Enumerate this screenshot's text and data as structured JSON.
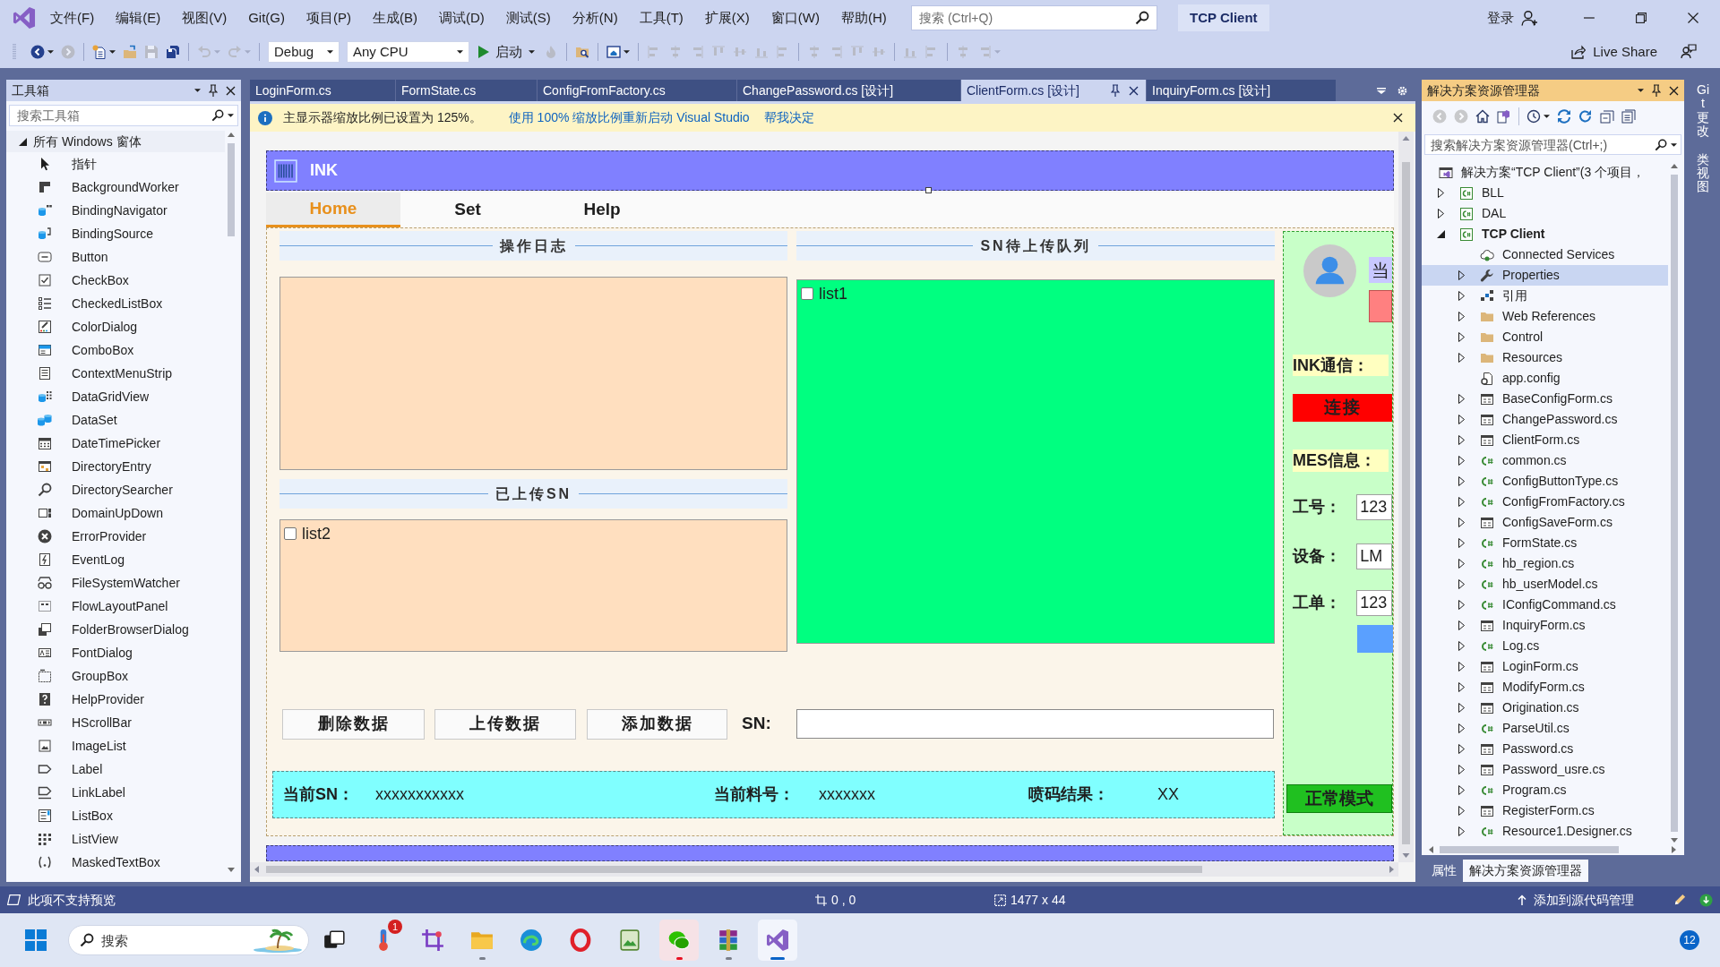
{
  "window": {
    "title": "TCP Client",
    "search_placeholder": "搜索 (Ctrl+Q)",
    "account": "登录"
  },
  "menu": [
    "文件(F)",
    "编辑(E)",
    "视图(V)",
    "Git(G)",
    "项目(P)",
    "生成(B)",
    "调试(D)",
    "测试(S)",
    "分析(N)",
    "工具(T)",
    "扩展(X)",
    "窗口(W)",
    "帮助(H)"
  ],
  "toolbar": {
    "groups": [
      [
        {
          "kind": "back",
          "disabled": false,
          "dropdown": true
        },
        {
          "kind": "forward",
          "disabled": true
        }
      ],
      [
        {
          "kind": "new",
          "disabled": false,
          "dropdown": true
        },
        {
          "kind": "open",
          "disabled": false
        },
        {
          "kind": "save",
          "disabled": true
        },
        {
          "kind": "saveall",
          "disabled": false
        }
      ],
      [
        {
          "kind": "undo",
          "disabled": true,
          "dropdown": true
        },
        {
          "kind": "redo",
          "disabled": true,
          "dropdown": true
        }
      ],
      [
        {
          "kind": "combo",
          "value": "Debug"
        },
        {
          "kind": "combo",
          "value": "Any CPU"
        },
        {
          "kind": "run",
          "label": "启动",
          "dropdown": true
        },
        {
          "kind": "flame",
          "disabled": true
        }
      ],
      [
        {
          "kind": "browse",
          "disabled": false
        }
      ],
      [
        {
          "kind": "designer",
          "disabled": false,
          "dropdown": true
        }
      ],
      [
        {
          "kind": "layout",
          "disabled": true
        },
        {
          "kind": "layout",
          "disabled": true
        },
        {
          "kind": "layout",
          "disabled": true
        },
        {
          "kind": "layout",
          "disabled": true
        },
        {
          "kind": "layout",
          "disabled": true
        },
        {
          "kind": "layout",
          "disabled": true
        },
        {
          "kind": "layout",
          "disabled": true
        }
      ],
      [
        {
          "kind": "layout",
          "disabled": true
        },
        {
          "kind": "layout",
          "disabled": true
        },
        {
          "kind": "layout",
          "disabled": true
        },
        {
          "kind": "layout",
          "disabled": true
        }
      ],
      [
        {
          "kind": "layout",
          "disabled": true
        },
        {
          "kind": "layout",
          "disabled": true
        }
      ],
      [
        {
          "kind": "layout",
          "disabled": true
        },
        {
          "kind": "layout",
          "disabled": true,
          "dropdown": true
        }
      ]
    ],
    "live_share": "Live Share"
  },
  "toolbox": {
    "title": "工具箱",
    "search_placeholder": "搜索工具箱",
    "category": {
      "label": "所有 Windows 窗体",
      "expanded": true
    },
    "items": [
      {
        "label": "指针",
        "kind": "pointer",
        "selected": false
      },
      {
        "label": "BackgroundWorker",
        "kind": "worker",
        "selected": false
      },
      {
        "label": "BindingNavigator",
        "kind": "navigator",
        "selected": false
      },
      {
        "label": "BindingSource",
        "kind": "source",
        "selected": false
      },
      {
        "label": "Button",
        "kind": "button",
        "selected": false
      },
      {
        "label": "CheckBox",
        "kind": "checkbox",
        "selected": false
      },
      {
        "label": "CheckedListBox",
        "kind": "checklist",
        "selected": false
      },
      {
        "label": "ColorDialog",
        "kind": "palette",
        "selected": false
      },
      {
        "label": "ComboBox",
        "kind": "combo",
        "selected": false
      },
      {
        "label": "ContextMenuStrip",
        "kind": "menu",
        "selected": false
      },
      {
        "label": "DataGridView",
        "kind": "grid",
        "selected": false
      },
      {
        "label": "DataSet",
        "kind": "dataset",
        "selected": false
      },
      {
        "label": "DateTimePicker",
        "kind": "calendar",
        "selected": false
      },
      {
        "label": "DirectoryEntry",
        "kind": "directory",
        "selected": false
      },
      {
        "label": "DirectorySearcher",
        "kind": "search",
        "selected": false
      },
      {
        "label": "DomainUpDown",
        "kind": "updown",
        "selected": false
      },
      {
        "label": "ErrorProvider",
        "kind": "error",
        "selected": false
      },
      {
        "label": "EventLog",
        "kind": "log",
        "selected": false
      },
      {
        "label": "FileSystemWatcher",
        "kind": "watcher",
        "selected": false
      },
      {
        "label": "FlowLayoutPanel",
        "kind": "flow",
        "selected": false
      },
      {
        "label": "FolderBrowserDialog",
        "kind": "folderdialog",
        "selected": false
      },
      {
        "label": "FontDialog",
        "kind": "font",
        "selected": false
      },
      {
        "label": "GroupBox",
        "kind": "group",
        "selected": false
      },
      {
        "label": "HelpProvider",
        "kind": "help",
        "selected": false
      },
      {
        "label": "HScrollBar",
        "kind": "hscroll",
        "selected": false
      },
      {
        "label": "ImageList",
        "kind": "image",
        "selected": false
      },
      {
        "label": "Label",
        "kind": "label",
        "selected": false
      },
      {
        "label": "LinkLabel",
        "kind": "link",
        "selected": false
      },
      {
        "label": "ListBox",
        "kind": "listbox",
        "selected": false
      },
      {
        "label": "ListView",
        "kind": "listview",
        "selected": false
      },
      {
        "label": "MaskedTextBox",
        "kind": "masked",
        "selected": false
      }
    ]
  },
  "document_tabs": [
    {
      "label": "LoginForm.cs",
      "selected": false
    },
    {
      "label": "FormState.cs",
      "selected": false
    },
    {
      "label": "ConfigFromFactory.cs",
      "selected": false
    },
    {
      "label": "ChangePassword.cs [设计]",
      "selected": false
    },
    {
      "label": "ClientForm.cs [设计]",
      "selected": true
    },
    {
      "label": "InquiryForm.cs [设计]",
      "selected": false
    }
  ],
  "info_bar": {
    "message": "主显示器缩放比例已设置为 125%。",
    "links": [
      "使用 100% 缩放比例重新启动 Visual Studio",
      "帮我决定"
    ]
  },
  "designer": {
    "form": {
      "title": "INK",
      "tabs": [
        {
          "label": "Home",
          "selected": true
        },
        {
          "label": "Set",
          "selected": false
        },
        {
          "label": "Help",
          "selected": false
        }
      ],
      "log": {
        "title": "操作日志"
      },
      "uploaded": {
        "title": "已上传SN",
        "items": [
          {
            "label": "list2",
            "checked": false
          }
        ]
      },
      "queue": {
        "title": "SN待上传队列",
        "items": [
          {
            "label": "list1",
            "checked": false
          }
        ]
      },
      "buttons": [
        "删除数据",
        "上传数据",
        "添加数据"
      ],
      "sn_label": "SN:",
      "status": [
        {
          "label": "当前SN：",
          "value": "xxxxxxxxxxx"
        },
        {
          "label": "当前料号：",
          "value": "xxxxxxx"
        },
        {
          "label": "喷码结果：",
          "value": "XX"
        }
      ],
      "side": {
        "user_label": "当",
        "ink_label": "INK通信：",
        "connect_button": "连接",
        "mes_label": "MES信息：",
        "fields": [
          {
            "label": "工号：",
            "value": "123"
          },
          {
            "label": "设备：",
            "value": "LM"
          },
          {
            "label": "工单：",
            "value": "123"
          }
        ],
        "mode_button": "正常模式"
      }
    }
  },
  "solution_explorer": {
    "title": "解决方案资源管理器",
    "toolbar": [
      [
        {
          "kind": "back",
          "disabled": true
        },
        {
          "kind": "forward",
          "disabled": true
        },
        {
          "kind": "home",
          "disabled": false
        },
        {
          "kind": "views",
          "disabled": false
        }
      ],
      [
        {
          "kind": "history",
          "disabled": false,
          "dropdown": true
        },
        {
          "kind": "sync",
          "disabled": false
        },
        {
          "kind": "refresh",
          "disabled": false
        },
        {
          "kind": "collapse",
          "disabled": false
        },
        {
          "kind": "pages",
          "disabled": false
        }
      ]
    ],
    "search_placeholder": "搜索解决方案资源管理器(Ctrl+;)",
    "tree": [
      {
        "label": "解决方案“TCP Client”(3 个项目，",
        "kind": "solution",
        "selected": false,
        "children": [
          {
            "label": "BLL",
            "kind": "project",
            "expanded": false,
            "startup": false,
            "selected": false
          },
          {
            "label": "DAL",
            "kind": "project",
            "expanded": false,
            "startup": false,
            "selected": false
          },
          {
            "label": "TCP Client",
            "kind": "project",
            "expanded": true,
            "startup": true,
            "selected": false,
            "children": [
              {
                "label": "Connected Services",
                "kind": "services",
                "selected": false
              },
              {
                "label": "Properties",
                "kind": "properties",
                "expanded": false,
                "selected": true
              },
              {
                "label": "引用",
                "kind": "references",
                "expanded": false,
                "selected": false
              },
              {
                "label": "Web References",
                "kind": "folder",
                "expanded": false,
                "selected": false
              },
              {
                "label": "Control",
                "kind": "folder",
                "expanded": false,
                "selected": false
              },
              {
                "label": "Resources",
                "kind": "folder",
                "expanded": false,
                "selected": false
              },
              {
                "label": "app.config",
                "kind": "config",
                "selected": false
              },
              {
                "label": "BaseConfigForm.cs",
                "kind": "form",
                "expanded": false,
                "selected": false
              },
              {
                "label": "ChangePassword.cs",
                "kind": "form",
                "expanded": false,
                "selected": false
              },
              {
                "label": "ClientForm.cs",
                "kind": "form",
                "expanded": false,
                "selected": false
              },
              {
                "label": "common.cs",
                "kind": "csharp",
                "expanded": false,
                "selected": false
              },
              {
                "label": "ConfigButtonType.cs",
                "kind": "csharp",
                "expanded": false,
                "selected": false
              },
              {
                "label": "ConfigFromFactory.cs",
                "kind": "csharp",
                "expanded": false,
                "selected": false
              },
              {
                "label": "ConfigSaveForm.cs",
                "kind": "form",
                "expanded": false,
                "selected": false
              },
              {
                "label": "FormState.cs",
                "kind": "csharp",
                "expanded": false,
                "selected": false
              },
              {
                "label": "hb_region.cs",
                "kind": "csharp",
                "expanded": false,
                "selected": false
              },
              {
                "label": "hb_userModel.cs",
                "kind": "csharp",
                "expanded": false,
                "selected": false
              },
              {
                "label": "IConfigCommand.cs",
                "kind": "csharp",
                "expanded": false,
                "selected": false
              },
              {
                "label": "InquiryForm.cs",
                "kind": "form",
                "expanded": false,
                "selected": false
              },
              {
                "label": "Log.cs",
                "kind": "csharp",
                "expanded": false,
                "selected": false
              },
              {
                "label": "LoginForm.cs",
                "kind": "form",
                "expanded": false,
                "selected": false
              },
              {
                "label": "ModifyForm.cs",
                "kind": "form",
                "expanded": false,
                "selected": false
              },
              {
                "label": "Origination.cs",
                "kind": "form",
                "expanded": false,
                "selected": false
              },
              {
                "label": "ParseUtil.cs",
                "kind": "csharp",
                "expanded": false,
                "selected": false
              },
              {
                "label": "Password.cs",
                "kind": "form",
                "expanded": false,
                "selected": false
              },
              {
                "label": "Password_usre.cs",
                "kind": "form",
                "expanded": false,
                "selected": false
              },
              {
                "label": "Program.cs",
                "kind": "csharp",
                "expanded": false,
                "selected": false
              },
              {
                "label": "RegisterForm.cs",
                "kind": "form",
                "expanded": false,
                "selected": false
              },
              {
                "label": "Resource1.Designer.cs",
                "kind": "csharp",
                "expanded": false,
                "selected": false
              }
            ]
          }
        ]
      }
    ],
    "tabs": [
      {
        "label": "属性",
        "selected": false
      },
      {
        "label": "解决方案资源管理器",
        "selected": true
      }
    ]
  },
  "side_tabs": [
    "Git 更改",
    "类视图"
  ],
  "status_bar": {
    "message": "此项不支持预览",
    "position": "0 , 0",
    "size": "1477 x 44",
    "source_control": "添加到源代码管理"
  },
  "taskbar": {
    "search_placeholder": "搜索",
    "apps": [
      {
        "kind": "taskview",
        "running": false,
        "focused": false,
        "flashing": false
      },
      {
        "kind": "thermometer",
        "running": false,
        "focused": false,
        "flashing": false,
        "badge": "1"
      },
      {
        "kind": "crop",
        "running": false,
        "focused": false,
        "flashing": false
      },
      {
        "kind": "folder",
        "running": true,
        "focused": false,
        "flashing": false
      },
      {
        "kind": "swirl",
        "running": false,
        "focused": false,
        "flashing": false
      },
      {
        "kind": "ring",
        "running": false,
        "focused": false,
        "flashing": false
      },
      {
        "kind": "picture",
        "running": false,
        "focused": false,
        "flashing": false
      },
      {
        "kind": "chat",
        "running": true,
        "focused": false,
        "flashing": true
      },
      {
        "kind": "books",
        "running": true,
        "focused": false,
        "flashing": false
      },
      {
        "kind": "ribbon",
        "running": true,
        "focused": true,
        "flashing": false
      }
    ],
    "notifications": "12"
  }
}
